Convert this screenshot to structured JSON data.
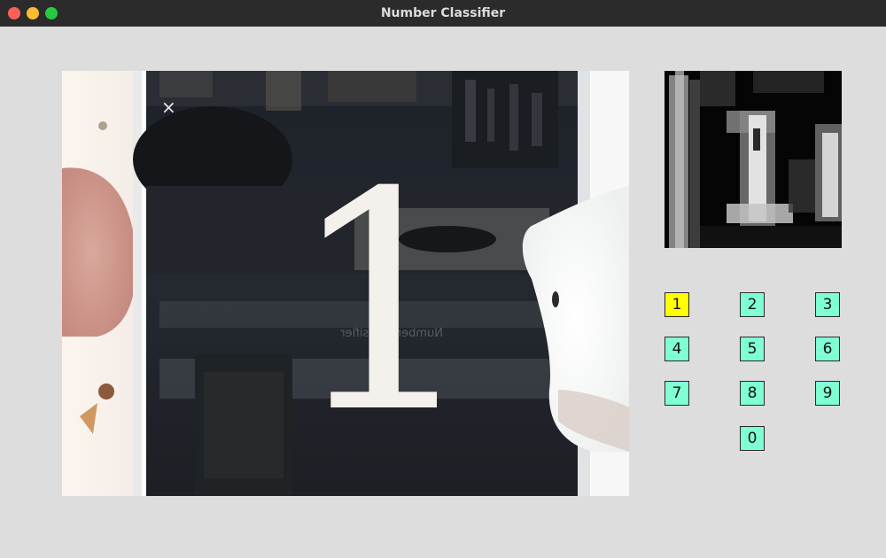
{
  "window": {
    "title": "Number Classifier"
  },
  "camera": {
    "digit_shown": "1",
    "mirrored_caption": "Number Classifier"
  },
  "digits": [
    {
      "label": "1",
      "active": true
    },
    {
      "label": "2",
      "active": false
    },
    {
      "label": "3",
      "active": false
    },
    {
      "label": "4",
      "active": false
    },
    {
      "label": "5",
      "active": false
    },
    {
      "label": "6",
      "active": false
    },
    {
      "label": "7",
      "active": false
    },
    {
      "label": "8",
      "active": false
    },
    {
      "label": "9",
      "active": false
    },
    {
      "label": "0",
      "active": false
    }
  ],
  "colors": {
    "button_default": "#7fffd4",
    "button_active": "#ffff00",
    "background": "#dddddd",
    "titlebar": "#2b2b2b"
  }
}
